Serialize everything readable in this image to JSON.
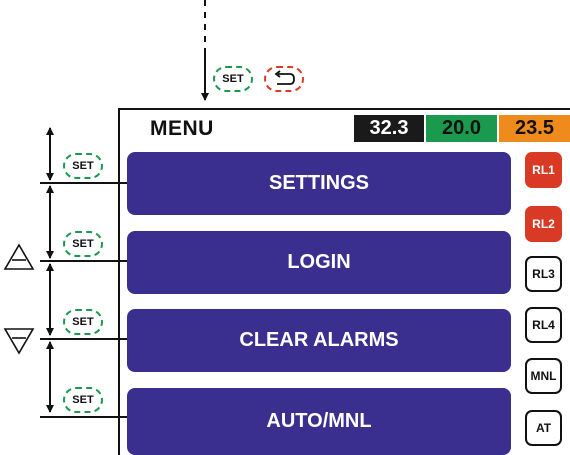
{
  "menu": {
    "title": "MENU",
    "items": [
      {
        "label": "SETTINGS"
      },
      {
        "label": "LOGIN"
      },
      {
        "label": "CLEAR ALARMS"
      },
      {
        "label": "AUTO/MNL"
      }
    ]
  },
  "readings": [
    {
      "value": "32.3",
      "color": "#1a1a1a"
    },
    {
      "value": "20.0",
      "color": "#1b9a4f"
    },
    {
      "value": "23.5",
      "color": "#ef8a1c"
    }
  ],
  "relays": [
    {
      "label": "RL1",
      "state": "on"
    },
    {
      "label": "RL2",
      "state": "on"
    },
    {
      "label": "RL3",
      "state": "off"
    },
    {
      "label": "RL4",
      "state": "off"
    },
    {
      "label": "MNL",
      "state": "off"
    },
    {
      "label": "AT",
      "state": "off"
    }
  ],
  "keys": {
    "set_label": "SET",
    "back_icon": "back-arrow-icon",
    "up_icon": "triangle-up-icon",
    "down_icon": "triangle-down-icon"
  },
  "colors": {
    "menu_item_bg": "#3a2e8f",
    "relay_on": "#d83a26",
    "set_outline": "#1b9a4f",
    "back_outline": "#d83a26"
  }
}
